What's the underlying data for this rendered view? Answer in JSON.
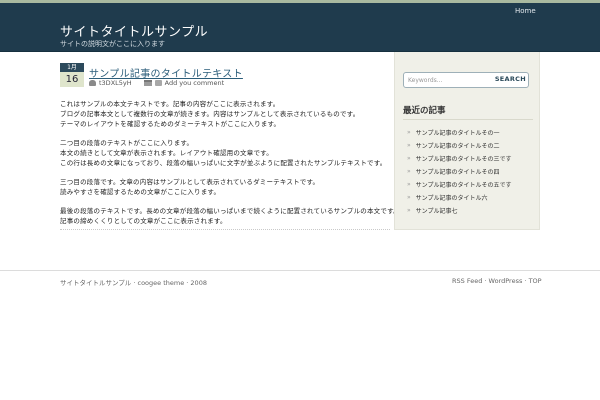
{
  "header": {
    "site_title": "サイトタイトルサンプル",
    "site_description": "サイトの説明文がここに入ります",
    "nav_home": "Home"
  },
  "post": {
    "date_month": "1月",
    "date_day": "16",
    "title": "サンプル記事のタイトルテキスト",
    "author": "t3DXL5yH",
    "comment_link": "Add you comment",
    "paragraphs": [
      [
        "これはサンプルの本文テキストです。記事の内容がここに表示されます。",
        "ブログの記事本文として複数行の文章が続きます。内容はサンプルとして表示されているものです。",
        "テーマのレイアウトを確認するためのダミーテキストがここに入ります。"
      ],
      [
        "二つ目の段落のテキストがここに入ります。",
        "本文の続きとして文章が表示されます。レイアウト確認用の文章です。",
        "この行は長めの文章になっており、段落の幅いっぱいに文字が並ぶように配置されたサンプルテキストです。"
      ],
      [
        "三つ目の段落です。文章の内容はサンプルとして表示されているダミーテキストです。",
        "読みやすさを確認するための文章がここに入ります。"
      ],
      [
        "最後の段落のテキストです。長めの文章が段落の幅いっぱいまで続くように配置されているサンプルの本文です。",
        "記事の締めくくりとしての文章がここに表示されます。"
      ]
    ]
  },
  "sidebar": {
    "search_placeholder": "Keywords...",
    "search_button": "SEARCH",
    "heading": "最近の記事",
    "recent_posts": [
      "サンプル記事のタイトルその一",
      "サンプル記事のタイトルその二",
      "サンプル記事のタイトルその三です",
      "サンプル記事のタイトルその四",
      "サンプル記事のタイトルその五です",
      "サンプル記事のタイトル六",
      "サンプル記事七"
    ]
  },
  "footer": {
    "left_text": "サイトタイトルサンプル · coogee theme · 2008",
    "rss_feed": "RSS Feed",
    "wordpress": "WordPress",
    "top": "TOP",
    "separator": " · "
  }
}
